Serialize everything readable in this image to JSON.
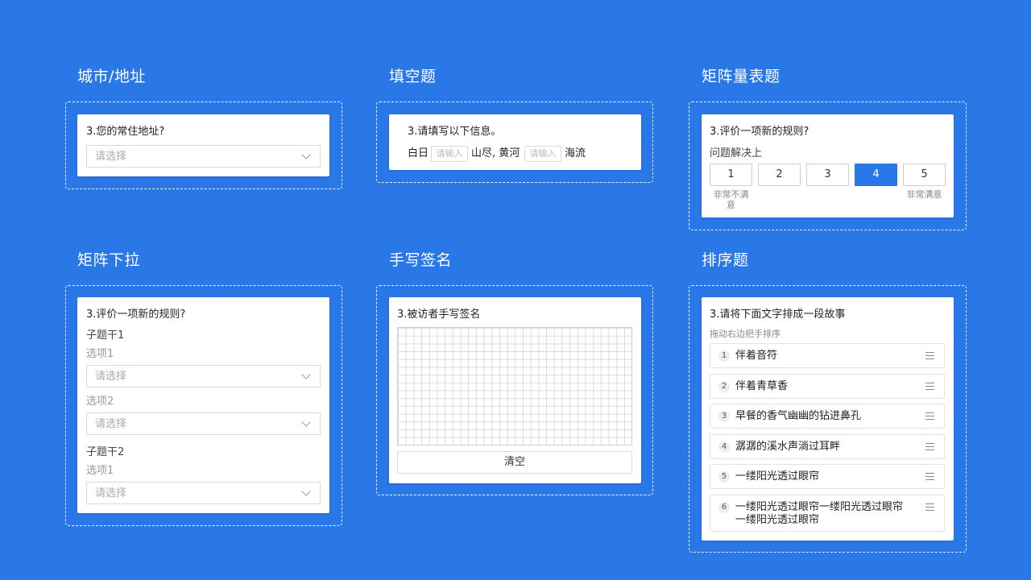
{
  "sections": {
    "city": {
      "title": "城市/地址",
      "question": "3.您的常住地址?",
      "placeholder": "请选择"
    },
    "fill": {
      "title": "填空题",
      "question": "3.请填写以下信息。",
      "part1": "白日",
      "input1": "请输入",
      "part2": "山尽, 黄河",
      "input2": "请输入",
      "part3": "海流"
    },
    "matrix_scale": {
      "title": "矩阵量表题",
      "question": "3.评价一项新的规则?",
      "row_label": "问题解决上",
      "options": [
        "1",
        "2",
        "3",
        "4",
        "5"
      ],
      "selected": "4",
      "low_label": "非常不满意",
      "high_label": "非常满意"
    },
    "matrix_dropdown": {
      "title": "矩阵下拉",
      "question": "3.评价一项新的规则?",
      "sub1": "子题干1",
      "sub1_opt1": "选项1",
      "sub1_opt2": "选项2",
      "sub2": "子题干2",
      "sub2_opt1": "选项1",
      "placeholder": "请选择"
    },
    "signature": {
      "title": "手写签名",
      "question": "3.被访者手写签名",
      "clear_label": "清空"
    },
    "ranking": {
      "title": "排序题",
      "question": "3.请将下面文字排成一段故事",
      "hint": "拖动右边把手排序",
      "items": [
        {
          "num": "1",
          "text": "伴着音符"
        },
        {
          "num": "2",
          "text": "伴着青草香"
        },
        {
          "num": "3",
          "text": "早餐的香气幽幽的钻进鼻孔"
        },
        {
          "num": "4",
          "text": "潺潺的溪水声淌过耳畔"
        },
        {
          "num": "5",
          "text": "一缕阳光透过眼帘"
        },
        {
          "num": "6",
          "text": "一缕阳光透过眼帘一缕阳光透过眼帘一缕阳光透过眼帘"
        }
      ]
    }
  },
  "colors": {
    "background": "#2a77e8",
    "accent": "#2a77e8",
    "card": "#ffffff"
  },
  "icons": {
    "dropdown": "chevron-down-icon",
    "drag": "drag-handle-icon"
  }
}
